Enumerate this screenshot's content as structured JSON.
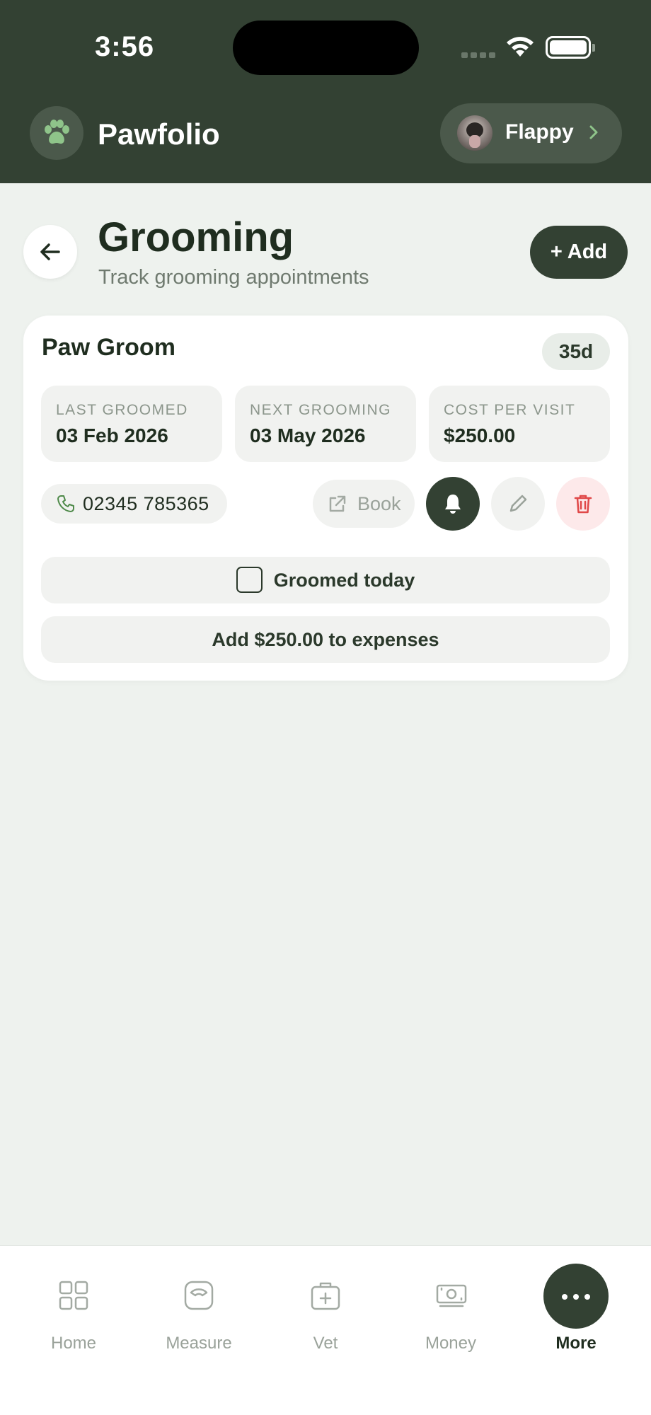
{
  "status_bar": {
    "time": "3:56"
  },
  "header": {
    "app_title": "Pawfolio",
    "pet_name": "Flappy"
  },
  "page": {
    "title": "Grooming",
    "subtitle": "Track grooming appointments",
    "add_label": "+ Add"
  },
  "card": {
    "provider_name": "Paw Groom",
    "days_badge": "35d",
    "stats": [
      {
        "label": "LAST GROOMED",
        "value": "03 Feb 2026"
      },
      {
        "label": "NEXT GROOMING",
        "value": "03 May 2026"
      },
      {
        "label": "COST PER VISIT",
        "value": "$250.00"
      }
    ],
    "phone": "02345 785365",
    "book_label": "Book",
    "groomed_today_label": "Groomed today",
    "add_expense_label": "Add $250.00 to expenses"
  },
  "nav": {
    "items": [
      {
        "label": "Home",
        "icon": "grid-icon"
      },
      {
        "label": "Measure",
        "icon": "scale-icon"
      },
      {
        "label": "Vet",
        "icon": "medical-bag-icon"
      },
      {
        "label": "Money",
        "icon": "banknote-icon"
      },
      {
        "label": "More",
        "icon": "more-dots-icon",
        "active": true
      }
    ]
  },
  "colors": {
    "header_bg": "#334133",
    "page_bg": "#eef2ee",
    "accent_dark": "#334133",
    "delete_red": "#e04848"
  }
}
